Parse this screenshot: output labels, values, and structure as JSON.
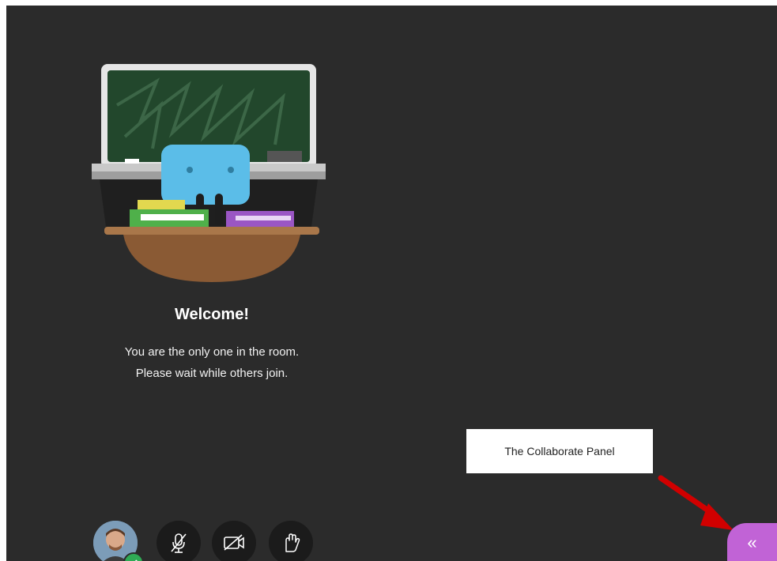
{
  "welcome": {
    "title": "Welcome!",
    "line1": "You are the only one in the room.",
    "line2": "Please wait while others join."
  },
  "callout": {
    "text": "The Collaborate Panel"
  },
  "panel_toggle": {
    "glyph": "«",
    "color": "#c163d6",
    "icon": "double-chevron-left-icon"
  },
  "controls": [
    {
      "name": "avatar",
      "icon": "user-avatar"
    },
    {
      "name": "microphone",
      "icon": "microphone-off-icon"
    },
    {
      "name": "camera",
      "icon": "camera-off-icon"
    },
    {
      "name": "raise-hand",
      "icon": "raise-hand-icon"
    }
  ],
  "colors": {
    "background": "#2b2b2b",
    "annotation_arrow": "#d10000",
    "status_ok": "#2faa55"
  }
}
